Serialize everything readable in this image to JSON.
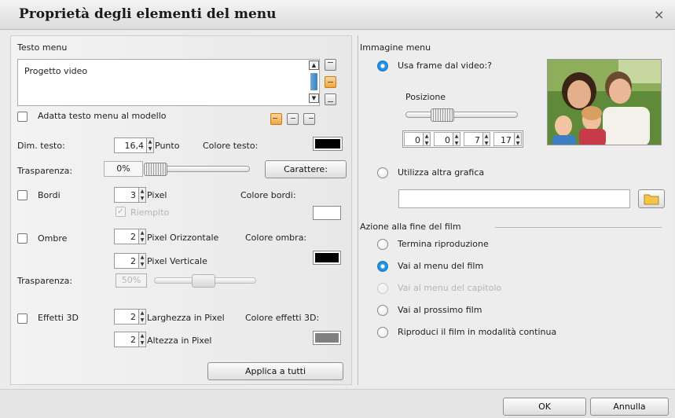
{
  "dialog": {
    "title": "Proprietà degli elementi del menu",
    "close_label": "×"
  },
  "left": {
    "testo_menu": {
      "label": "Testo menu",
      "text": "Progetto video",
      "adatta_label": "Adatta testo menu al modello",
      "adatta_checked": false
    },
    "dim_testo": {
      "label": "Dim. testo:",
      "value": "16,4",
      "unit": "Punto"
    },
    "colore_testo": {
      "label": "Colore testo:",
      "color": "#000000"
    },
    "trasparenza1": {
      "label": "Trasparenza:",
      "value": "0%",
      "level_percent": 0
    },
    "carattere_button": "Carattere:",
    "bordi": {
      "label": "Bordi",
      "checked": false,
      "value": "3",
      "unit": "Pixel",
      "color_label": "Colore bordi:",
      "color": "#ffffff",
      "riempito_label": "Riempito",
      "riempito_checked": true
    },
    "ombre": {
      "label": "Ombre",
      "checked": false,
      "h_value": "2",
      "h_unit": "Pixel Orizzontale",
      "v_value": "2",
      "v_unit": "Pixel Verticale",
      "color_label": "Colore ombra:",
      "color": "#000000"
    },
    "trasparenza2": {
      "label": "Trasparenza:",
      "value": "50%",
      "level_percent": 50
    },
    "effetti3d": {
      "label": "Effetti 3D",
      "checked": false,
      "w_value": "2",
      "w_unit": "Larghezza in Pixel",
      "h_value": "2",
      "h_unit": "Altezza in Pixel",
      "color_label": "Colore effetti 3D:",
      "color": "#808080"
    },
    "applica_button": "Applica a tutti"
  },
  "right": {
    "immagine_menu": {
      "label": "Immagine menu",
      "usa_frame_label": "Usa frame dal video:?",
      "usa_frame_selected": true,
      "posizione_label": "Posizione",
      "timecode": [
        "0",
        "0",
        "7",
        "17"
      ],
      "utilizza_label": "Utilizza altra grafica",
      "utilizza_selected": false,
      "path_value": ""
    },
    "azione": {
      "label": "Azione alla fine del film",
      "options": [
        {
          "label": "Termina riproduzione",
          "selected": false,
          "enabled": true
        },
        {
          "label": "Vai al menu del film",
          "selected": true,
          "enabled": true
        },
        {
          "label": "Vai al menu del capitolo",
          "selected": false,
          "enabled": false
        },
        {
          "label": "Vai al prossimo film",
          "selected": false,
          "enabled": true
        },
        {
          "label": "Riproduci il film in modalità continua",
          "selected": false,
          "enabled": true
        }
      ]
    }
  },
  "footer": {
    "ok_label": "OK",
    "cancel_label": "Annulla"
  },
  "colors": {
    "accent": "#1f7fc9",
    "highlight": "#f2a43c"
  }
}
